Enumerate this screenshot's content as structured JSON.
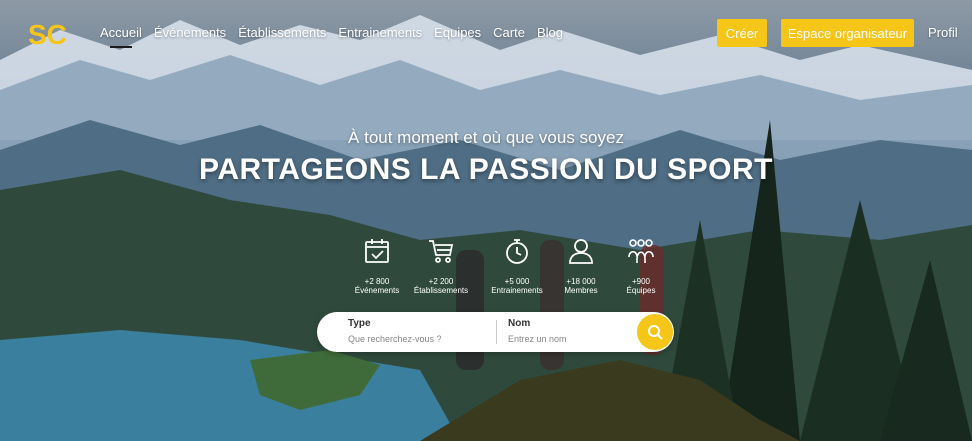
{
  "nav": {
    "logo_text": "SC",
    "items": [
      {
        "label": "Accueil",
        "active": true
      },
      {
        "label": "Événements"
      },
      {
        "label": "Établissements"
      },
      {
        "label": "Entrainements"
      },
      {
        "label": "Equipes"
      },
      {
        "label": "Carte"
      },
      {
        "label": "Blog"
      }
    ],
    "create_label": "Créer",
    "organizer_label": "Espace organisateur",
    "profile_label": "Profil"
  },
  "hero": {
    "tagline": "À tout moment et où que vous soyez",
    "headline": "PARTAGEONS LA PASSION DU SPORT"
  },
  "stats": [
    {
      "icon": "calendar-icon",
      "value": "+2 800",
      "label": "Événements"
    },
    {
      "icon": "cart-icon",
      "value": "+2 200",
      "label": "Établissements"
    },
    {
      "icon": "stopwatch-icon",
      "value": "+5 000",
      "label": "Entrainements"
    },
    {
      "icon": "user-icon",
      "value": "+18 000",
      "label": "Membres"
    },
    {
      "icon": "team-icon",
      "value": "+900",
      "label": "Équipes"
    }
  ],
  "search": {
    "type_label": "Type",
    "type_placeholder": "Que recherchez-vous ?",
    "name_label": "Nom",
    "name_placeholder": "Entrez un nom",
    "button_icon": "search-icon"
  },
  "colors": {
    "accent": "#f5c518",
    "text_on_hero": "#ffffff"
  }
}
